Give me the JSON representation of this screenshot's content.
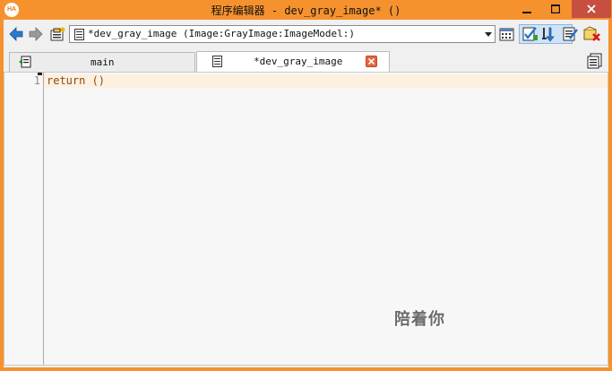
{
  "window": {
    "app_logo": "HA",
    "title": "程序编辑器 - dev_gray_image* ()"
  },
  "toolbar": {
    "procedure_select_value": "*dev_gray_image (Image:GrayImage:ImageModel:)",
    "icons": [
      "back-arrow-icon",
      "forward-arrow-icon",
      "procedure-interface-icon",
      "document-icon",
      "calendar-icon",
      "edit-check-icon",
      "step-down-icon",
      "edit-list-icon",
      "delete-procedure-icon"
    ]
  },
  "tabs": [
    {
      "label": "main",
      "active": false
    },
    {
      "label": "*dev_gray_image",
      "active": true
    }
  ],
  "editor": {
    "lines": [
      {
        "number": "1",
        "code": "return ()"
      }
    ]
  },
  "overlay": {
    "caption": "陪着你"
  },
  "colors": {
    "title_bar": "#f6922e",
    "close_button": "#c74f3f",
    "code_text": "#8b4a15",
    "current_line": "#fdf0e0"
  }
}
